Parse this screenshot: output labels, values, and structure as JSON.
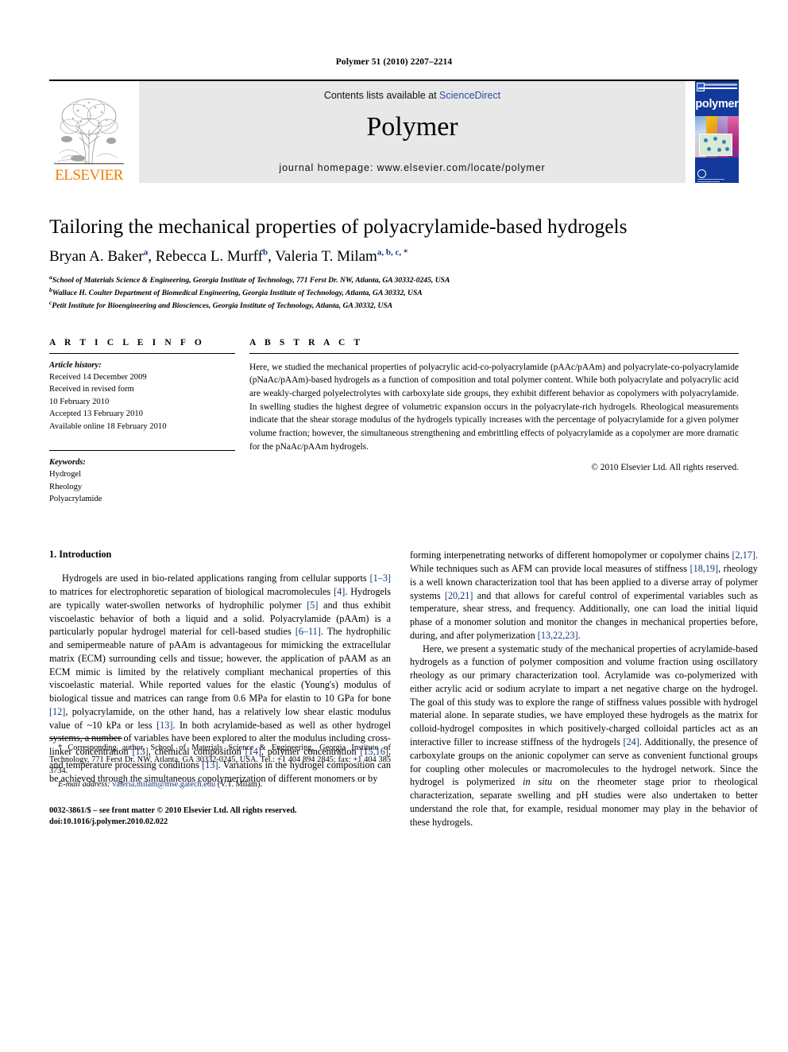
{
  "running_head": "Polymer 51 (2010) 2207–2214",
  "masthead": {
    "publisher_wordmark": "ELSEVIER",
    "contents_prefix": "Contents lists available at ",
    "sciencedirect": "ScienceDirect",
    "journal_title": "Polymer",
    "homepage": "journal homepage: www.elsevier.com/locate/polymer",
    "cover_word": "polymer",
    "accent_orange": "#f07d00",
    "accent_link_blue": "#2b4ba0",
    "cover_blue": "#12399b"
  },
  "article": {
    "title": "Tailoring the mechanical properties of polyacrylamide-based hydrogels",
    "authors": [
      {
        "name": "Bryan A. Baker",
        "marks": "a"
      },
      {
        "name": "Rebecca L. Murff",
        "marks": "b"
      },
      {
        "name": "Valeria T. Milam",
        "marks": "a, b, c, *"
      }
    ],
    "affiliations": [
      {
        "mark": "a",
        "text": "School of Materials Science & Engineering, Georgia Institute of Technology, 771 Ferst Dr. NW, Atlanta, GA 30332-0245, USA"
      },
      {
        "mark": "b",
        "text": "Wallace H. Coulter Department of Biomedical Engineering, Georgia Institute of Technology, Atlanta, GA 30332, USA"
      },
      {
        "mark": "c",
        "text": "Petit Institute for Bioengineering and Biosciences, Georgia Institute of Technology, Atlanta, GA 30332, USA"
      }
    ]
  },
  "article_info": {
    "heading": "A R T I C L E   I N F O",
    "history_label": "Article history:",
    "history": [
      "Received 14 December 2009",
      "Received in revised form",
      "10 February 2010",
      "Accepted 13 February 2010",
      "Available online 18 February 2010"
    ],
    "keywords_label": "Keywords:",
    "keywords": [
      "Hydrogel",
      "Rheology",
      "Polyacrylamide"
    ]
  },
  "abstract": {
    "heading": "A B S T R A C T",
    "text": "Here, we studied the mechanical properties of polyacrylic acid-co-polyacrylamide (pAAc/pAAm) and polyacrylate-co-polyacrylamide (pNaAc/pAAm)-based hydrogels as a function of composition and total polymer content. While both polyacrylate and polyacrylic acid are weakly-charged polyelectrolytes with carboxylate side groups, they exhibit different behavior as copolymers with polyacrylamide. In swelling studies the highest degree of volumetric expansion occurs in the polyacrylate-rich hydrogels. Rheological measurements indicate that the shear storage modulus of the hydrogels typically increases with the percentage of polyacrylamide for a given polymer volume fraction; however, the simultaneous strengthening and embrittling effects of polyacrylamide as a copolymer are more dramatic for the pNaAc/pAAm hydrogels.",
    "copyright": "© 2010 Elsevier Ltd. All rights reserved."
  },
  "body": {
    "section_title": "1.  Introduction",
    "left_paragraph_1_part1": "Hydrogels are used in bio-related applications ranging from cellular supports ",
    "left_ref_1": "[1–3]",
    "left_paragraph_1_part2": " to matrices for electrophoretic separation of biological macromolecules ",
    "left_ref_2": "[4]",
    "left_paragraph_1_part3": ". Hydrogels are typically water-swollen networks of hydrophilic polymer ",
    "left_ref_3": "[5]",
    "left_paragraph_1_part4": " and thus exhibit viscoelastic behavior of both a liquid and a solid. Polyacrylamide (pAAm) is a particularly popular hydrogel material for cell-based studies ",
    "left_ref_4": "[6–11]",
    "left_paragraph_1_part5": ". The hydrophilic and semipermeable nature of pAAm is advantageous for mimicking the extracellular matrix (ECM) surrounding cells and tissue; however, the application of pAAM as an ECM mimic is limited by the relatively compliant mechanical properties of this viscoelastic material. While reported values for the elastic (Young's) modulus of biological tissue and matrices can range from 0.6 MPa for elastin to 10 GPa for bone ",
    "left_ref_5": "[12]",
    "left_paragraph_1_part6": ", polyacrylamide, on the other hand, has a relatively low shear elastic modulus value of ~10 kPa or less ",
    "left_ref_6": "[13]",
    "left_paragraph_1_part7": ". In both acrylamide-based as well as other hydrogel systems, a number of variables have been explored to alter the modulus including cross-linker concentration ",
    "left_ref_7": "[13]",
    "left_paragraph_1_part8": ", chemical composition ",
    "left_ref_8": "[14]",
    "left_paragraph_1_part9": ", polymer concentration ",
    "left_ref_9": "[15,16]",
    "left_paragraph_1_part10": ", and temperature processing conditions ",
    "left_ref_10": "[13]",
    "left_paragraph_1_part11": ". Variations in the hydrogel composition can be achieved through the simultaneous copolymerization of different monomers or by",
    "right_paragraph_1_part1": "forming interpenetrating networks of different homopolymer or copolymer chains ",
    "right_ref_1": "[2,17]",
    "right_paragraph_1_part2": ". While techniques such as AFM can provide local measures of stiffness ",
    "right_ref_2": "[18,19]",
    "right_paragraph_1_part3": ", rheology is a well known characterization tool that has been applied to a diverse array of polymer systems ",
    "right_ref_3": "[20,21]",
    "right_paragraph_1_part4": " and that allows for careful control of experimental variables such as temperature, shear stress, and frequency. Additionally, one can load the initial liquid phase of a monomer solution and monitor the changes in mechanical properties before, during, and after polymerization ",
    "right_ref_4": "[13,22,23]",
    "right_paragraph_1_part5": ".",
    "right_paragraph_2_part1": "Here, we present a systematic study of the mechanical properties of acrylamide-based hydrogels as a function of polymer composition and volume fraction using oscillatory rheology as our primary characterization tool. Acrylamide was co-polymerized with either acrylic acid or sodium acrylate to impart a net negative charge on the hydrogel. The goal of this study was to explore the range of stiffness values possible with hydrogel material alone. In separate studies, we have employed these hydrogels as the matrix for colloid-hydrogel composites in which positively-charged colloidal particles act as an interactive filler to increase stiffness of the hydrogels ",
    "right_ref_5": "[24]",
    "right_paragraph_2_part2": ". Additionally, the presence of carboxylate groups on the anionic copolymer can serve as convenient functional groups for coupling other molecules or macromolecules to the hydrogel network. Since the hydrogel is polymerized ",
    "right_italic_1": "in situ",
    "right_paragraph_2_part3": " on the rheometer stage prior to rheological characterization, separate swelling and pH studies were also undertaken to better understand the role that, for example, residual monomer may play in the behavior of these hydrogels."
  },
  "footnote": {
    "corresponding": "* Corresponding author. School of Materials Science & Engineering, Georgia Institute of Technology, 771 Ferst Dr. NW, Atlanta, GA 30332-0245, USA. Tel.: +1 404 894 2845; fax: +1 404 385 3734.",
    "email_label": "E-mail address:",
    "email": "valeria.milam@mse.gatech.edu",
    "email_suffix": "(V.T. Milam).",
    "issn_line": "0032-3861/$ – see front matter © 2010 Elsevier Ltd. All rights reserved.",
    "doi_line": "doi:10.1016/j.polymer.2010.02.022"
  }
}
